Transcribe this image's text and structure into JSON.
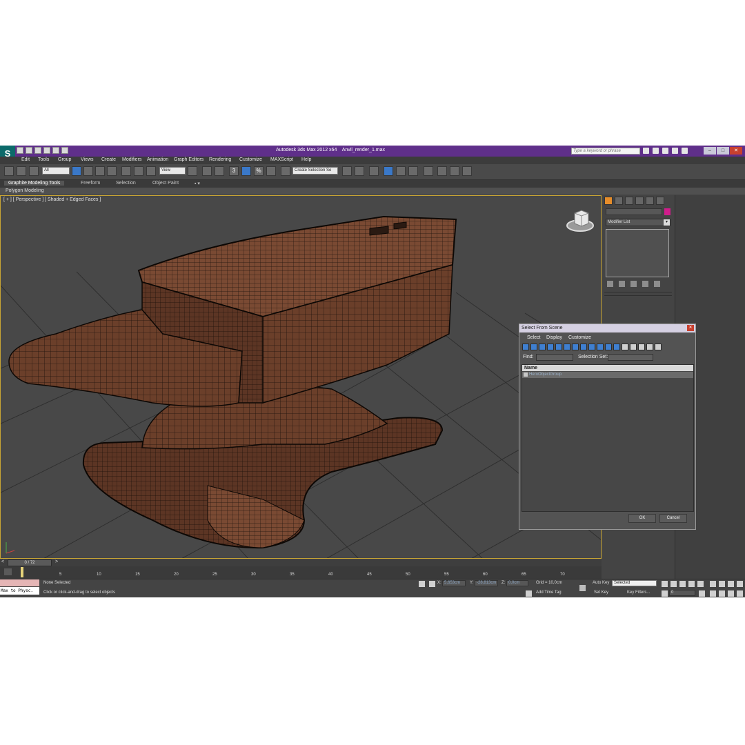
{
  "window": {
    "title": "Autodesk 3ds Max  2012 x64",
    "file": "Anvil_render_1.max",
    "search_placeholder": "Type a keyword or phrase",
    "min": "–",
    "max": "□",
    "close": "✕"
  },
  "app_icon": "3ds-max-logo-icon",
  "menu": [
    "Edit",
    "Tools",
    "Group",
    "Views",
    "Create",
    "Modifiers",
    "Animation",
    "Graph Editors",
    "Rendering",
    "Customize",
    "MAXScript",
    "Help"
  ],
  "toolbar": {
    "selection_filter": "All",
    "reference_coord": "View",
    "named_selection_placeholder": "Create Selection Se",
    "snap_label": "3",
    "percent_snap": "%"
  },
  "ribbon": {
    "tabs": [
      "Graphite Modeling Tools",
      "Freeform",
      "Selection",
      "Object Paint"
    ],
    "active_tab": "Graphite Modeling Tools",
    "panel_label": "Polygon Modeling"
  },
  "viewport": {
    "label": "[ + ] [ Perspective ] [ Shaded + Edged Faces ]",
    "object": "anvil mesh",
    "accent": "#c9a534"
  },
  "command_panel": {
    "modifier_list_label": "Modifier List",
    "object_color": "#d01c8b",
    "active_tab_color": "#e68d2a"
  },
  "select_dialog": {
    "title": "Select From Scene",
    "menu": [
      "Select",
      "Display",
      "Customize"
    ],
    "find_label": "Find:",
    "selection_set_label": "Selection Set:",
    "column_name": "Name",
    "items": [
      "HeroObjectGroup"
    ],
    "ok_label": "OK",
    "cancel_label": "Cancel"
  },
  "timeline": {
    "frame_display": "0 / 72",
    "prev": "<",
    "next": ">",
    "ticks": [
      "5",
      "10",
      "15",
      "20",
      "25",
      "30",
      "35",
      "40",
      "45",
      "50",
      "55",
      "60",
      "65",
      "70"
    ]
  },
  "status": {
    "listener": "Max to Physc.",
    "selection": "None Selected",
    "prompt": "Click or click-and-drag to select objects",
    "x_label": "X:",
    "x_value": "5,653cm",
    "y_label": "Y:",
    "y_value": "-28,813cm",
    "z_label": "Z:",
    "z_value": "0,0cm",
    "grid": "Grid = 10,0cm",
    "add_time_tag": "Add Time Tag",
    "auto_key": "Auto Key",
    "auto_key_mode": "Selected",
    "set_key": "Set Key",
    "key_filters": "Key Filters...",
    "frame_field": "0"
  }
}
